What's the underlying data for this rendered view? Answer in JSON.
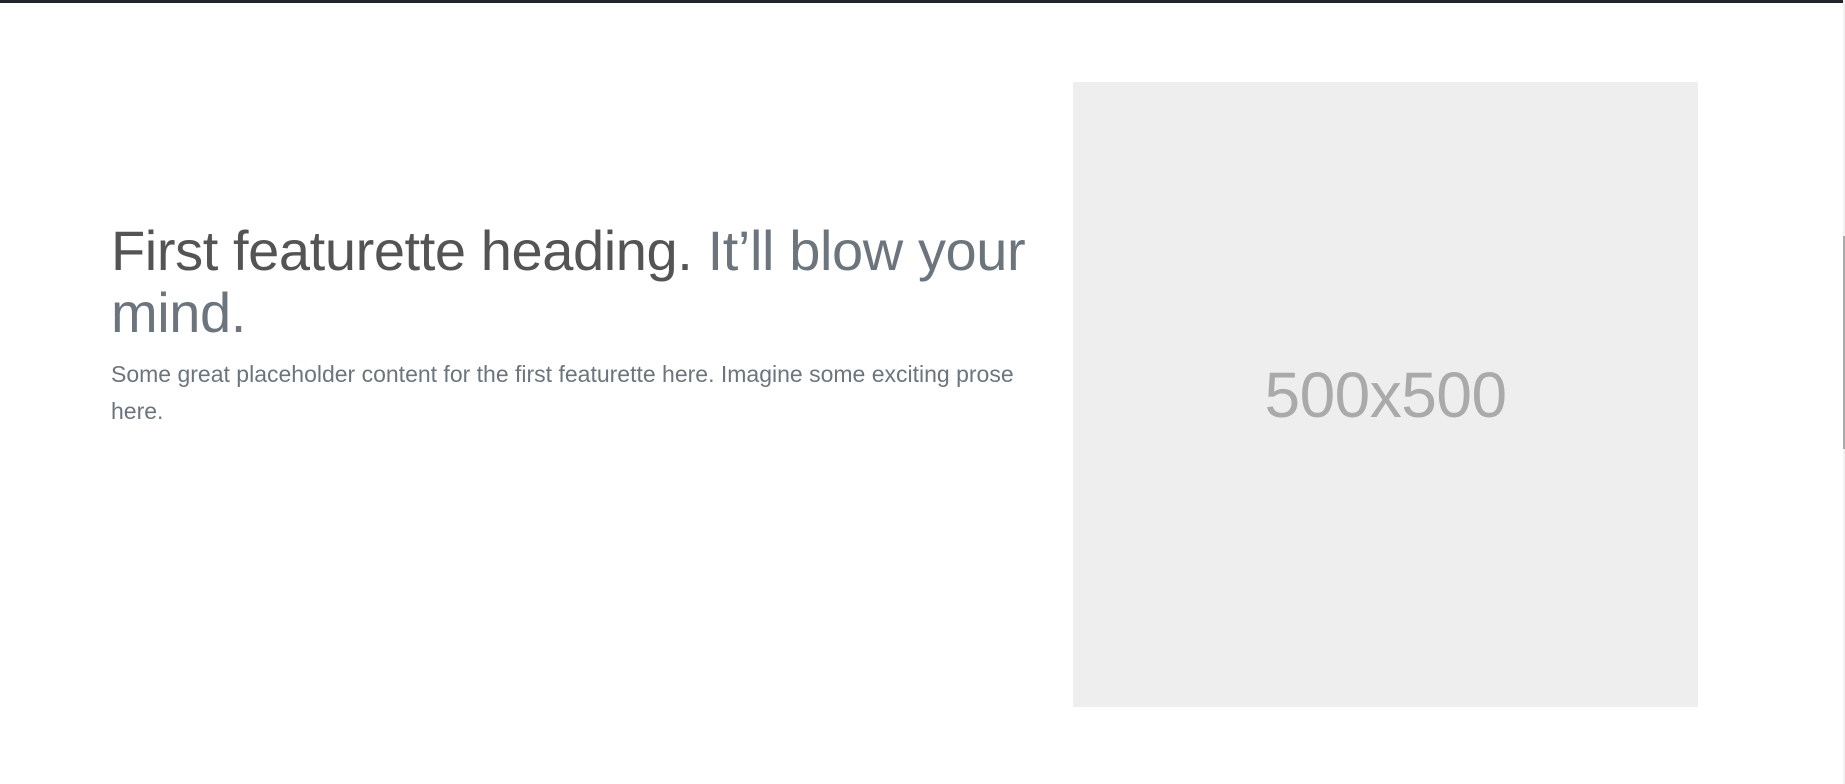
{
  "featurette": {
    "heading_main": "First featurette heading. ",
    "heading_muted": "It’ll blow your mind.",
    "lead": "Some great placeholder content for the first featurette here. Imagine some exciting prose here."
  },
  "image": {
    "label": "500x500"
  },
  "colors": {
    "heading": "#545454",
    "muted": "#6c757d",
    "placeholder_bg": "#eeeeee",
    "placeholder_text": "#aaaaaa",
    "top_rule": "#212529"
  }
}
